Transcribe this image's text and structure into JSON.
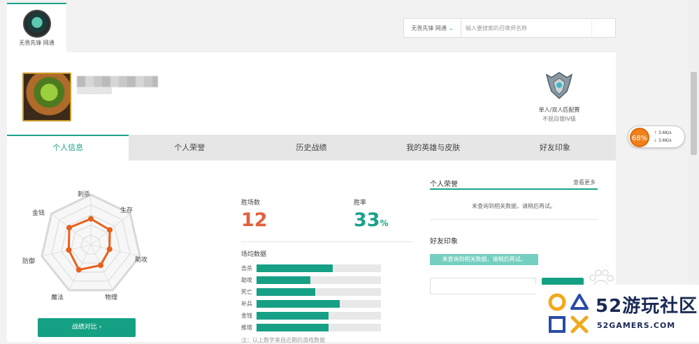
{
  "server": {
    "name": "无畏先锋 网通"
  },
  "search": {
    "server_select": "无畏先锋 网通",
    "placeholder": "输入要搜索的召唤师名称"
  },
  "profile": {
    "rank_queue": "单人/双人匹配赛",
    "rank_tier": "不屈白银IV级"
  },
  "tabs": [
    {
      "label": "个人信息",
      "active": true
    },
    {
      "label": "个人荣誉",
      "active": false
    },
    {
      "label": "历史战绩",
      "active": false
    },
    {
      "label": "我的英雄与皮肤",
      "active": false
    },
    {
      "label": "好友印象",
      "active": false
    }
  ],
  "radar": {
    "axes": [
      "刺杀",
      "生存",
      "助攻",
      "物理",
      "魔法",
      "防御",
      "金钱"
    ],
    "values": [
      0.52,
      0.48,
      0.38,
      0.45,
      0.55,
      0.45,
      0.55
    ],
    "compare_button": "战绩对比"
  },
  "stats": {
    "wins_label": "胜场数",
    "wins_value": "12",
    "rate_label": "胜率",
    "rate_value": "33",
    "rate_unit": "%",
    "avg_title": "场均数据",
    "bars": [
      {
        "label": "击杀",
        "value": 0.61
      },
      {
        "label": "助攻",
        "value": 0.43
      },
      {
        "label": "死亡",
        "value": 0.47
      },
      {
        "label": "补兵",
        "value": 0.67
      },
      {
        "label": "金钱",
        "value": 0.58
      },
      {
        "label": "推塔",
        "value": 0.58
      }
    ],
    "note": "注：以上数字来自近期的游戏数据"
  },
  "honor": {
    "title": "个人荣誉",
    "more": "查看更多",
    "empty": "未查询到相关数据，请稍后再试。"
  },
  "impression": {
    "title": "好友印象",
    "empty": "未查询到相关数据，请稍后再试。"
  },
  "net": {
    "percent": "68%",
    "up": "3.6K/s",
    "down": "3.6K/s"
  },
  "watermark": {
    "title": "52游玩社区",
    "sub": "52GAMERS.COM"
  },
  "colors": {
    "accent": "#19a38a",
    "wins": "#e2603e",
    "radar": "#e8601c"
  }
}
